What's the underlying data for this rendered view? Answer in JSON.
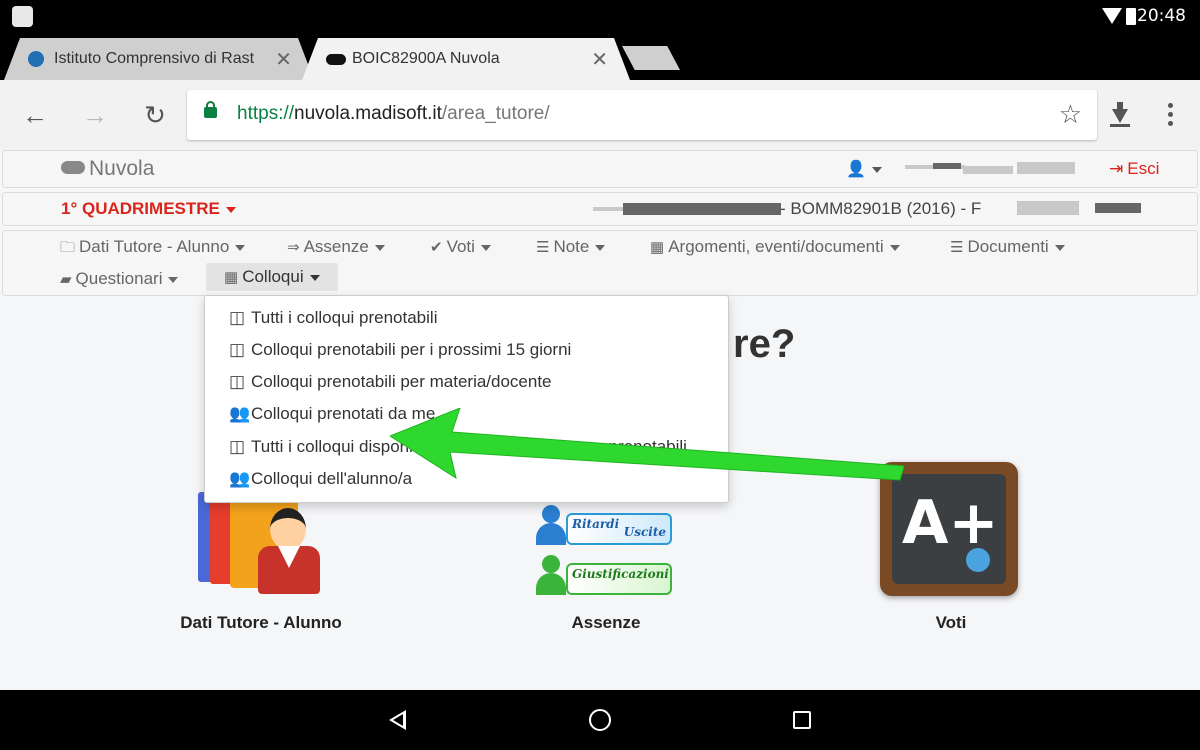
{
  "status_bar": {
    "time": "20:48"
  },
  "tabs": [
    {
      "title": "Istituto Comprensivo di Rast",
      "close": "✕"
    },
    {
      "title": "BOIC82900A Nuvola",
      "close": "✕"
    }
  ],
  "omnibox": {
    "scheme": "https://",
    "host": "nuvola.madisoft.it",
    "path": "/area_tutore/"
  },
  "site": {
    "brand": "Nuvola",
    "esci": "Esci",
    "quadrimestre": "1° QUADRIMESTRE",
    "school": "- BOMM82901B (2016) - F"
  },
  "menu": {
    "dati": "Dati Tutore - Alunno",
    "assenze": "Assenze",
    "voti": "Voti",
    "note": "Note",
    "argomenti": "Argomenti, eventi/documenti",
    "documenti": "Documenti",
    "questionari": "Questionari",
    "colloqui": "Colloqui"
  },
  "dropdown": [
    "Tutti i colloqui prenotabili",
    "Colloqui prenotabili per i prossimi 15 giorni",
    "Colloqui prenotabili per materia/docente",
    "Colloqui prenotati da me",
    "Tutti i colloqui disponibili per sola visione e non prenotabili",
    "Colloqui dell'alunno/a"
  ],
  "background_heading_fragment": "re?",
  "tiles": {
    "dati": "Dati Tutore - Alunno",
    "assenze": "Assenze",
    "voti": "Voti",
    "assenze_labels": {
      "ritardi": "Ritardi",
      "uscite": "Uscite",
      "giustificazioni": "Giustificazioni"
    },
    "voti_icon_text": "A+"
  },
  "colors": {
    "accent_red": "#d9251c",
    "secure_green": "#0b8043",
    "arrow_green": "#2fd82f"
  }
}
